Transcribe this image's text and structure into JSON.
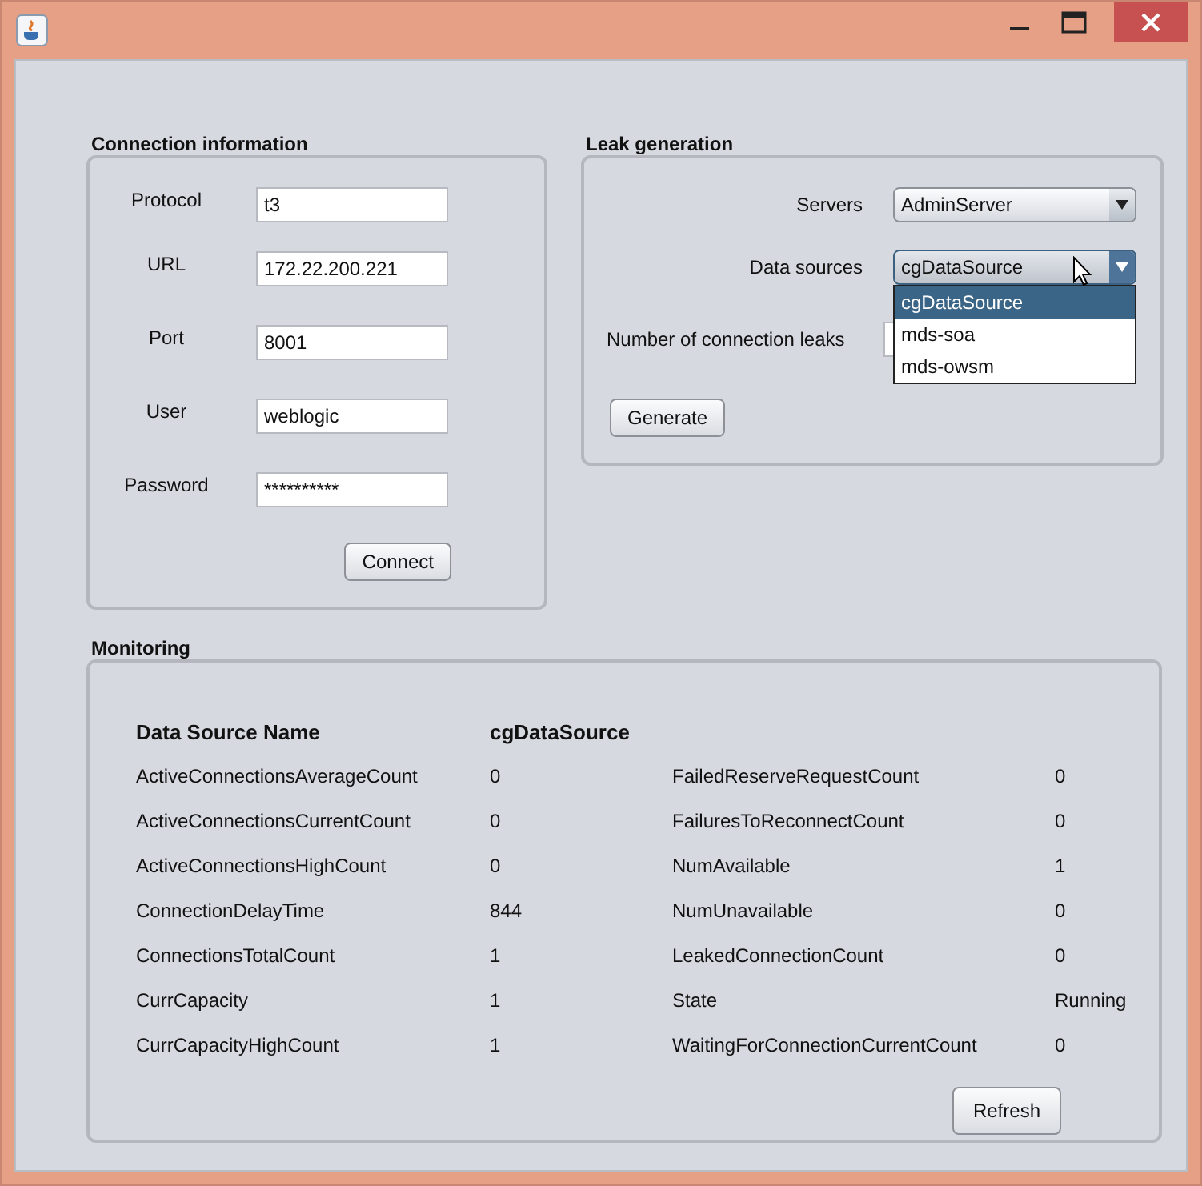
{
  "connection": {
    "title": "Connection information",
    "fields": [
      {
        "label": "Protocol",
        "value": "t3"
      },
      {
        "label": "URL",
        "value": "172.22.200.221"
      },
      {
        "label": "Port",
        "value": "8001"
      },
      {
        "label": "User",
        "value": "weblogic"
      },
      {
        "label": "Password",
        "value": "**********"
      }
    ],
    "button": "Connect"
  },
  "leak": {
    "title": "Leak generation",
    "servers": {
      "label": "Servers",
      "value": "AdminServer"
    },
    "data_sources": {
      "label": "Data sources",
      "value": "cgDataSource",
      "expanded": true,
      "options": [
        {
          "label": "cgDataSource",
          "selected": true
        },
        {
          "label": "mds-soa",
          "selected": false
        },
        {
          "label": "mds-owsm",
          "selected": false
        }
      ]
    },
    "leaks": {
      "label": "Number of connection leaks"
    },
    "button": "Generate"
  },
  "monitoring": {
    "title": "Monitoring",
    "header": {
      "name": "Data Source Name",
      "value": "cgDataSource"
    },
    "metrics": [
      {
        "name": "ActiveConnectionsAverageCount",
        "value": "0"
      },
      {
        "name": "FailedReserveRequestCount",
        "value": "0"
      },
      {
        "name": "ActiveConnectionsCurrentCount",
        "value": "0"
      },
      {
        "name": "FailuresToReconnectCount",
        "value": "0"
      },
      {
        "name": "ActiveConnectionsHighCount",
        "value": "0"
      },
      {
        "name": "NumAvailable",
        "value": "1"
      },
      {
        "name": "ConnectionDelayTime",
        "value": "844"
      },
      {
        "name": "NumUnavailable",
        "value": "0"
      },
      {
        "name": "ConnectionsTotalCount",
        "value": "1"
      },
      {
        "name": "LeakedConnectionCount",
        "value": "0"
      },
      {
        "name": "CurrCapacity",
        "value": "1"
      },
      {
        "name": "State",
        "value": "Running"
      },
      {
        "name": "CurrCapacityHighCount",
        "value": "1"
      },
      {
        "name": "WaitingForConnectionCurrentCount",
        "value": "0"
      }
    ],
    "button": "Refresh"
  }
}
